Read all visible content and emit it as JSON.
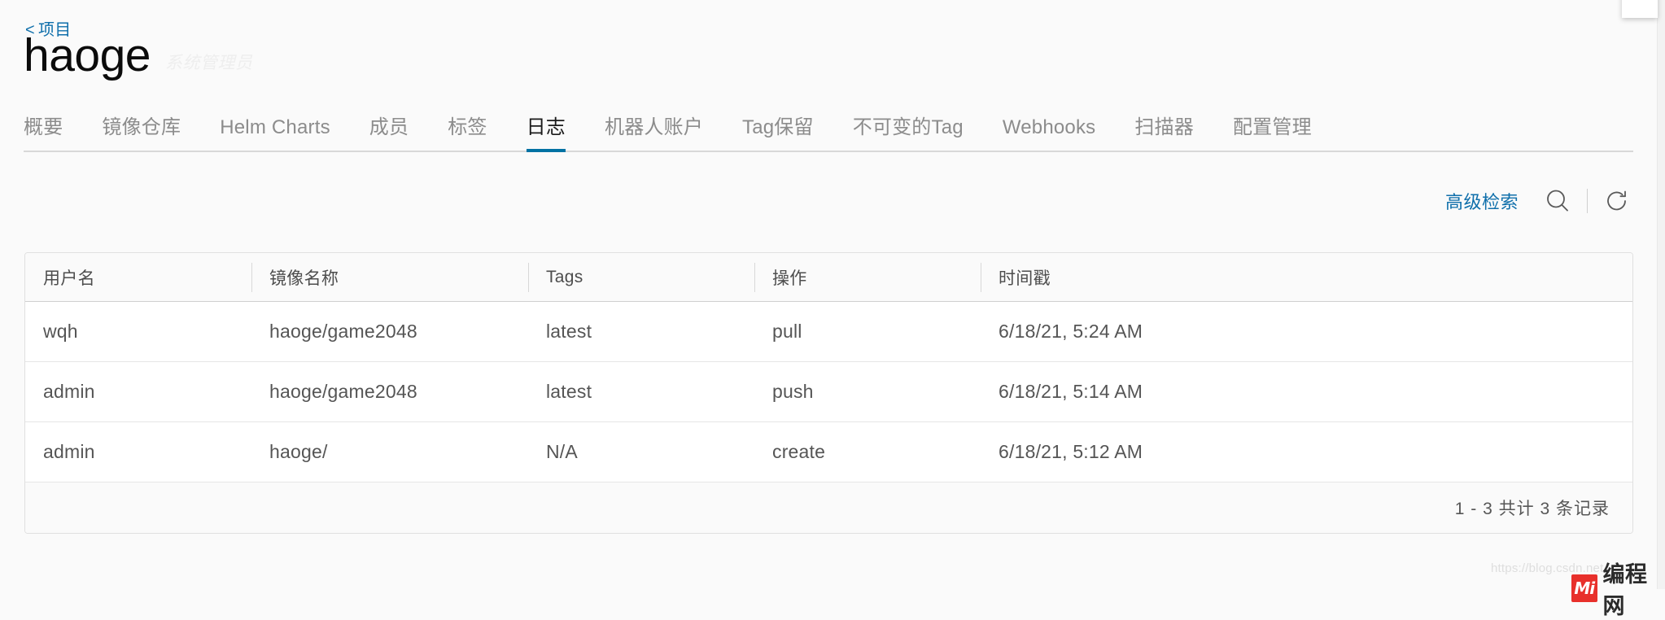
{
  "breadcrumb": {
    "back_chevron": "<",
    "label": "项目"
  },
  "header": {
    "project_name": "haoge",
    "role_label": "系统管理员"
  },
  "tabs": [
    {
      "label": "概要",
      "active": false
    },
    {
      "label": "镜像仓库",
      "active": false
    },
    {
      "label": "Helm Charts",
      "active": false
    },
    {
      "label": "成员",
      "active": false
    },
    {
      "label": "标签",
      "active": false
    },
    {
      "label": "日志",
      "active": true
    },
    {
      "label": "机器人账户",
      "active": false
    },
    {
      "label": "Tag保留",
      "active": false
    },
    {
      "label": "不可变的Tag",
      "active": false
    },
    {
      "label": "Webhooks",
      "active": false
    },
    {
      "label": "扫描器",
      "active": false
    },
    {
      "label": "配置管理",
      "active": false
    }
  ],
  "actionbar": {
    "advanced_search_label": "高级检索",
    "search_icon": "search-icon",
    "refresh_icon": "refresh-icon"
  },
  "table": {
    "columns": [
      "用户名",
      "镜像名称",
      "Tags",
      "操作",
      "时间戳"
    ],
    "rows": [
      {
        "username": "wqh",
        "repository": "haoge/game2048",
        "tags": "latest",
        "operation": "pull",
        "timestamp": "6/18/21, 5:24 AM"
      },
      {
        "username": "admin",
        "repository": "haoge/game2048",
        "tags": "latest",
        "operation": "push",
        "timestamp": "6/18/21, 5:14 AM"
      },
      {
        "username": "admin",
        "repository": "haoge/",
        "tags": "N/A",
        "operation": "create",
        "timestamp": "6/18/21, 5:12 AM"
      }
    ],
    "pagination_text": "1 - 3 共计 3 条记录"
  },
  "watermark": {
    "url": "https://blog.csdn.net",
    "logo_text": "Mi",
    "brand": "编程网"
  },
  "colors": {
    "link_blue": "#0f6fab",
    "active_tab_underline": "#0072a3",
    "watermark_red": "#e8302b",
    "page_background": "#fafafa",
    "table_background": "#ffffff"
  }
}
